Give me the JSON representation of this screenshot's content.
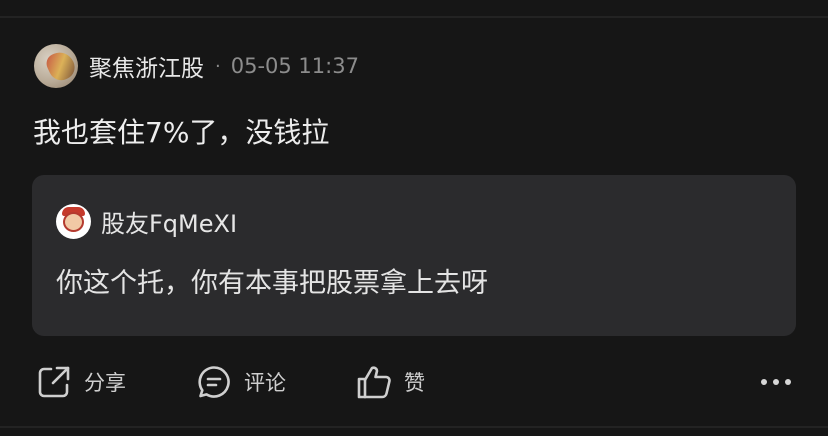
{
  "post": {
    "username": "聚焦浙江股",
    "separator": "·",
    "time": "05-05 11:37",
    "content": "我也套住7%了，没钱拉"
  },
  "quoted": {
    "username": "股友FqMeXI",
    "text": "你这个托，你有本事把股票拿上去呀"
  },
  "actions": {
    "share_label": "分享",
    "comment_label": "评论",
    "like_label": "赞",
    "share_icon": "share-icon",
    "comment_icon": "comment-icon",
    "like_icon": "thumbs-up-icon",
    "more_icon": "more-icon"
  },
  "colors": {
    "background": "#161616",
    "card": "#2b2b2d",
    "text": "#ededed",
    "muted": "#8c8c8c"
  }
}
